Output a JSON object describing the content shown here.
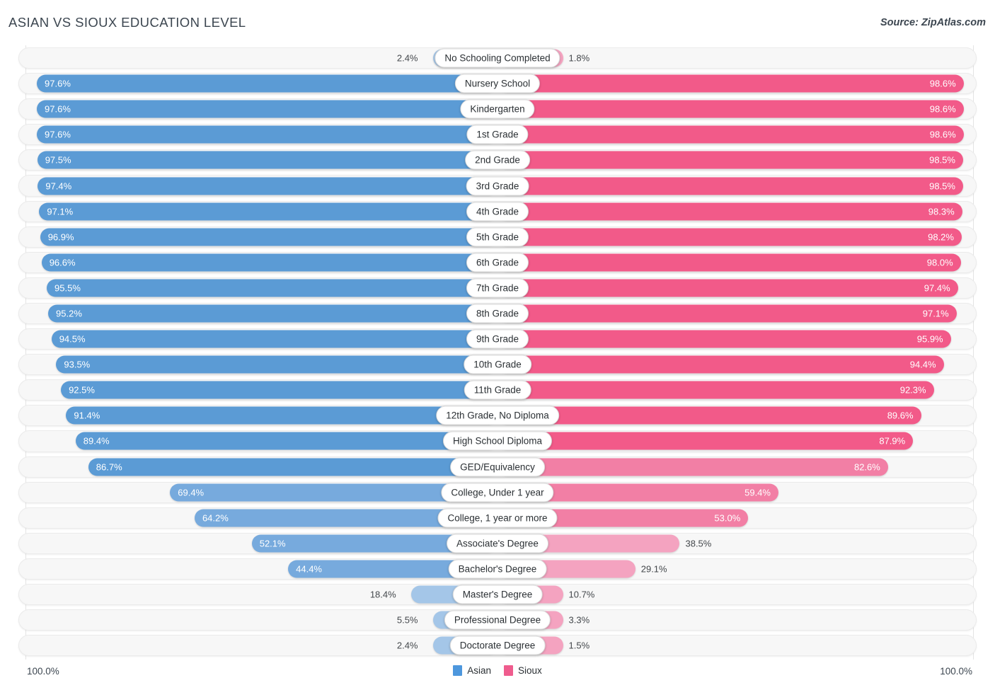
{
  "header": {
    "title": "ASIAN VS SIOUX EDUCATION LEVEL",
    "source": "Source: ZipAtlas.com"
  },
  "footer": {
    "axis_left": "100.0%",
    "axis_right": "100.0%",
    "legend": [
      {
        "label": "Asian",
        "color": "#4d97dd"
      },
      {
        "label": "Sioux",
        "color": "#ef5c8e"
      }
    ]
  },
  "colors": {
    "asian_strong": "#5b9bd5",
    "asian_mid": "#77aadd",
    "asian_light": "#a4c6e8",
    "sioux_strong": "#f25a89",
    "sioux_mid": "#f27fa5",
    "sioux_light": "#f4a3c0",
    "track": "#f7f7f7",
    "text_dark": "#3c4650"
  },
  "chart_data": {
    "type": "bar",
    "subtype": "diverging-bidirectional",
    "title": "ASIAN VS SIOUX EDUCATION LEVEL",
    "xlabel": "",
    "ylabel": "",
    "xlim": [
      0,
      100
    ],
    "axis_left_max": "100.0%",
    "axis_right_max": "100.0%",
    "grid": false,
    "legend_position": "bottom-center",
    "categories": [
      "No Schooling Completed",
      "Nursery School",
      "Kindergarten",
      "1st Grade",
      "2nd Grade",
      "3rd Grade",
      "4th Grade",
      "5th Grade",
      "6th Grade",
      "7th Grade",
      "8th Grade",
      "9th Grade",
      "10th Grade",
      "11th Grade",
      "12th Grade, No Diploma",
      "High School Diploma",
      "GED/Equivalency",
      "College, Under 1 year",
      "College, 1 year or more",
      "Associate's Degree",
      "Bachelor's Degree",
      "Master's Degree",
      "Professional Degree",
      "Doctorate Degree"
    ],
    "series": [
      {
        "name": "Asian",
        "side": "left",
        "color": "#4d97dd",
        "values": [
          2.4,
          97.6,
          97.6,
          97.6,
          97.5,
          97.4,
          97.1,
          96.9,
          96.6,
          95.5,
          95.2,
          94.5,
          93.5,
          92.5,
          91.4,
          89.4,
          86.7,
          69.4,
          64.2,
          52.1,
          44.4,
          18.4,
          5.5,
          2.4
        ]
      },
      {
        "name": "Sioux",
        "side": "right",
        "color": "#ef5c8e",
        "values": [
          1.8,
          98.6,
          98.6,
          98.6,
          98.5,
          98.5,
          98.3,
          98.2,
          98.0,
          97.4,
          97.1,
          95.9,
          94.4,
          92.3,
          89.6,
          87.9,
          82.6,
          59.4,
          53.0,
          38.5,
          29.1,
          10.7,
          3.3,
          1.5
        ]
      }
    ]
  },
  "rows": [
    {
      "label": "No Schooling Completed",
      "left": "2.4%",
      "right": "1.8%",
      "leftValue": 2.4,
      "rightValue": 1.8
    },
    {
      "label": "Nursery School",
      "left": "97.6%",
      "right": "98.6%",
      "leftValue": 97.6,
      "rightValue": 98.6
    },
    {
      "label": "Kindergarten",
      "left": "97.6%",
      "right": "98.6%",
      "leftValue": 97.6,
      "rightValue": 98.6
    },
    {
      "label": "1st Grade",
      "left": "97.6%",
      "right": "98.6%",
      "leftValue": 97.6,
      "rightValue": 98.6
    },
    {
      "label": "2nd Grade",
      "left": "97.5%",
      "right": "98.5%",
      "leftValue": 97.5,
      "rightValue": 98.5
    },
    {
      "label": "3rd Grade",
      "left": "97.4%",
      "right": "98.5%",
      "leftValue": 97.4,
      "rightValue": 98.5
    },
    {
      "label": "4th Grade",
      "left": "97.1%",
      "right": "98.3%",
      "leftValue": 97.1,
      "rightValue": 98.3
    },
    {
      "label": "5th Grade",
      "left": "96.9%",
      "right": "98.2%",
      "leftValue": 96.9,
      "rightValue": 98.2
    },
    {
      "label": "6th Grade",
      "left": "96.6%",
      "right": "98.0%",
      "leftValue": 96.6,
      "rightValue": 98.0
    },
    {
      "label": "7th Grade",
      "left": "95.5%",
      "right": "97.4%",
      "leftValue": 95.5,
      "rightValue": 97.4
    },
    {
      "label": "8th Grade",
      "left": "95.2%",
      "right": "97.1%",
      "leftValue": 95.2,
      "rightValue": 97.1
    },
    {
      "label": "9th Grade",
      "left": "94.5%",
      "right": "95.9%",
      "leftValue": 94.5,
      "rightValue": 95.9
    },
    {
      "label": "10th Grade",
      "left": "93.5%",
      "right": "94.4%",
      "leftValue": 93.5,
      "rightValue": 94.4
    },
    {
      "label": "11th Grade",
      "left": "92.5%",
      "right": "92.3%",
      "leftValue": 92.5,
      "rightValue": 92.3
    },
    {
      "label": "12th Grade, No Diploma",
      "left": "91.4%",
      "right": "89.6%",
      "leftValue": 91.4,
      "rightValue": 89.6
    },
    {
      "label": "High School Diploma",
      "left": "89.4%",
      "right": "87.9%",
      "leftValue": 89.4,
      "rightValue": 87.9
    },
    {
      "label": "GED/Equivalency",
      "left": "86.7%",
      "right": "82.6%",
      "leftValue": 86.7,
      "rightValue": 82.6
    },
    {
      "label": "College, Under 1 year",
      "left": "69.4%",
      "right": "59.4%",
      "leftValue": 69.4,
      "rightValue": 59.4
    },
    {
      "label": "College, 1 year or more",
      "left": "64.2%",
      "right": "53.0%",
      "leftValue": 64.2,
      "rightValue": 53.0
    },
    {
      "label": "Associate's Degree",
      "left": "52.1%",
      "right": "38.5%",
      "leftValue": 52.1,
      "rightValue": 38.5
    },
    {
      "label": "Bachelor's Degree",
      "left": "44.4%",
      "right": "29.1%",
      "leftValue": 44.4,
      "rightValue": 29.1
    },
    {
      "label": "Master's Degree",
      "left": "18.4%",
      "right": "10.7%",
      "leftValue": 18.4,
      "rightValue": 10.7
    },
    {
      "label": "Professional Degree",
      "left": "5.5%",
      "right": "3.3%",
      "leftValue": 5.5,
      "rightValue": 3.3
    },
    {
      "label": "Doctorate Degree",
      "left": "2.4%",
      "right": "1.5%",
      "leftValue": 2.4,
      "rightValue": 1.5
    }
  ]
}
